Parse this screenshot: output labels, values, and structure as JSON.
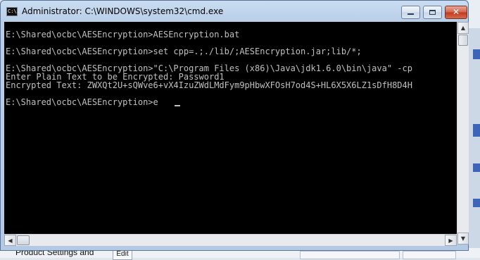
{
  "window": {
    "title": "Administrator: C:\\WINDOWS\\system32\\cmd.exe",
    "icon_label": "C:\\."
  },
  "console": {
    "lines": [
      "E:\\Shared\\ocbc\\AESEncryption>AESEncryption.bat",
      "",
      "E:\\Shared\\ocbc\\AESEncryption>set cpp=.;./lib/;AESEncryption.jar;lib/*;",
      "",
      "E:\\Shared\\ocbc\\AESEncryption>\"C:\\Program Files (x86)\\Java\\jdk1.6.0\\bin\\java\" -cp",
      "Enter Plain Text to be Encrypted: Password1",
      "Encrypted Text: ZWXQt2U+sQWve6+vX4IzuZWdLMdFym9pHbwXFOsH7od4S+HL6X5X6LZ1sDfH8D4H",
      "",
      "E:\\Shared\\ocbc\\AESEncryption>e"
    ],
    "text_color": "#c0c0c0",
    "background": "#000000"
  },
  "background_app": {
    "partial_text": "Product Settings and",
    "edit_label": "Edit"
  },
  "icons": {
    "minimize": "minimize-icon",
    "maximize": "maximize-icon",
    "close": "close-icon",
    "scroll_up": "arrow-up-icon",
    "scroll_down": "arrow-down-icon",
    "scroll_left": "arrow-left-icon",
    "scroll_right": "arrow-right-icon"
  },
  "glyphs": {
    "close": "✕",
    "up": "▲",
    "down": "▼",
    "left": "◀",
    "right": "▶"
  }
}
